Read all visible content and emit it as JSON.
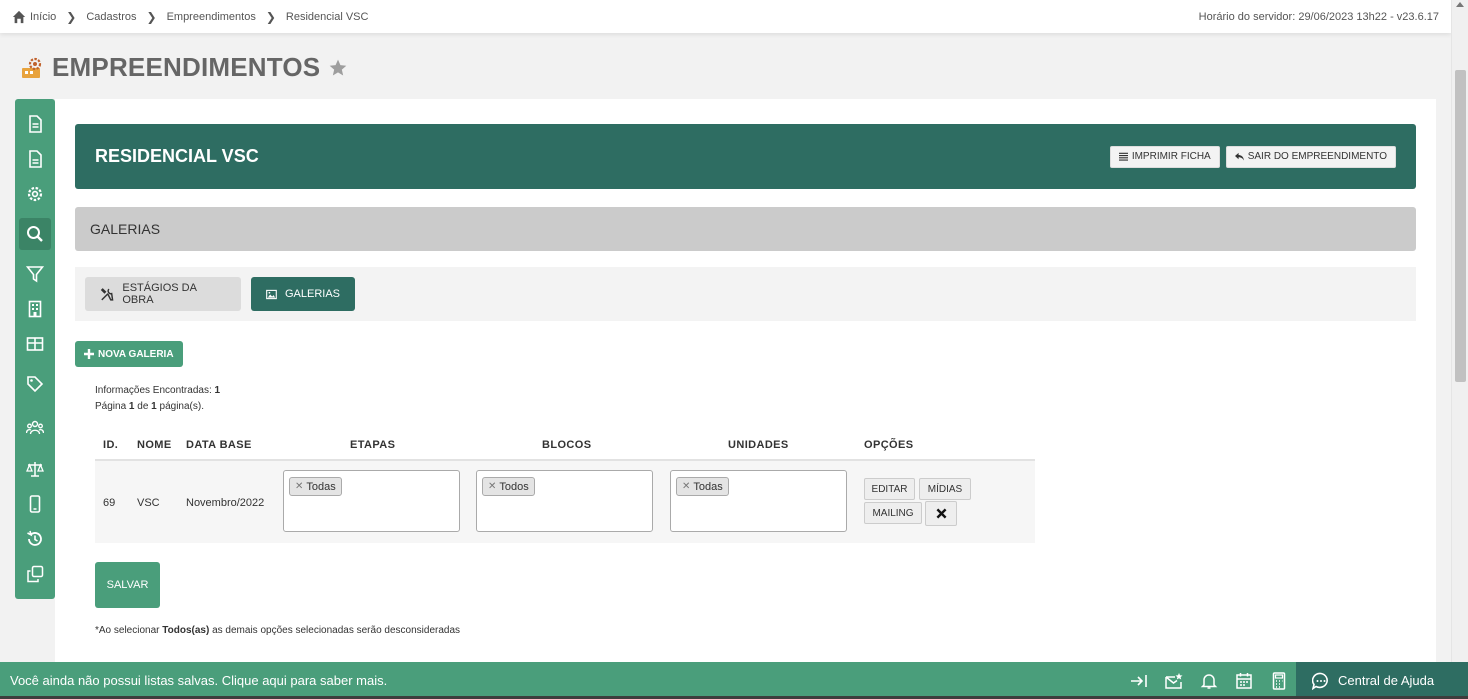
{
  "breadcrumb": [
    "Início",
    "Cadastros",
    "Empreendimentos",
    "Residencial VSC"
  ],
  "server_time": "Horário do servidor: 29/06/2023 13h22 - v23.6.17",
  "page_title": "EMPREENDIMENTOS",
  "header": {
    "title": "RESIDENCIAL VSC",
    "print_label": "IMPRIMIR FICHA",
    "exit_label": "SAIR DO EMPREENDIMENTO"
  },
  "section_title": "GALERIAS",
  "tabs": [
    {
      "label": "ESTÁGIOS DA OBRA",
      "active": false
    },
    {
      "label": "GALERIAS",
      "active": true
    }
  ],
  "new_gallery_label": "NOVA GALERIA",
  "info": {
    "found_label": "Informações Encontradas:",
    "found_count": "1",
    "page_label": "Página",
    "page_current": "1",
    "page_of": "de",
    "page_total": "1",
    "page_suffix": "página(s)."
  },
  "table": {
    "columns": [
      "ID.",
      "NOME",
      "DATA BASE",
      "ETAPAS",
      "BLOCOS",
      "UNIDADES",
      "OPÇÕES"
    ],
    "rows": [
      {
        "id": "69",
        "nome": "VSC",
        "data_base": "Novembro/2022",
        "etapas": "Todas",
        "blocos": "Todos",
        "unidades": "Todas"
      }
    ],
    "options": {
      "edit": "EDITAR",
      "media": "MÍDIAS",
      "mailing": "MAILING"
    }
  },
  "save_label": "SALVAR",
  "note": {
    "prefix": "*Ao selecionar",
    "bold": "Todos(as)",
    "suffix": "as demais opções selecionadas serão desconsideradas"
  },
  "footer": {
    "message": "Você ainda não possui listas salvas. Clique aqui para saber mais.",
    "help_label": "Central de Ajuda"
  },
  "colors": {
    "primary_dark": "#2e6d62",
    "primary": "#4a9e7b"
  }
}
